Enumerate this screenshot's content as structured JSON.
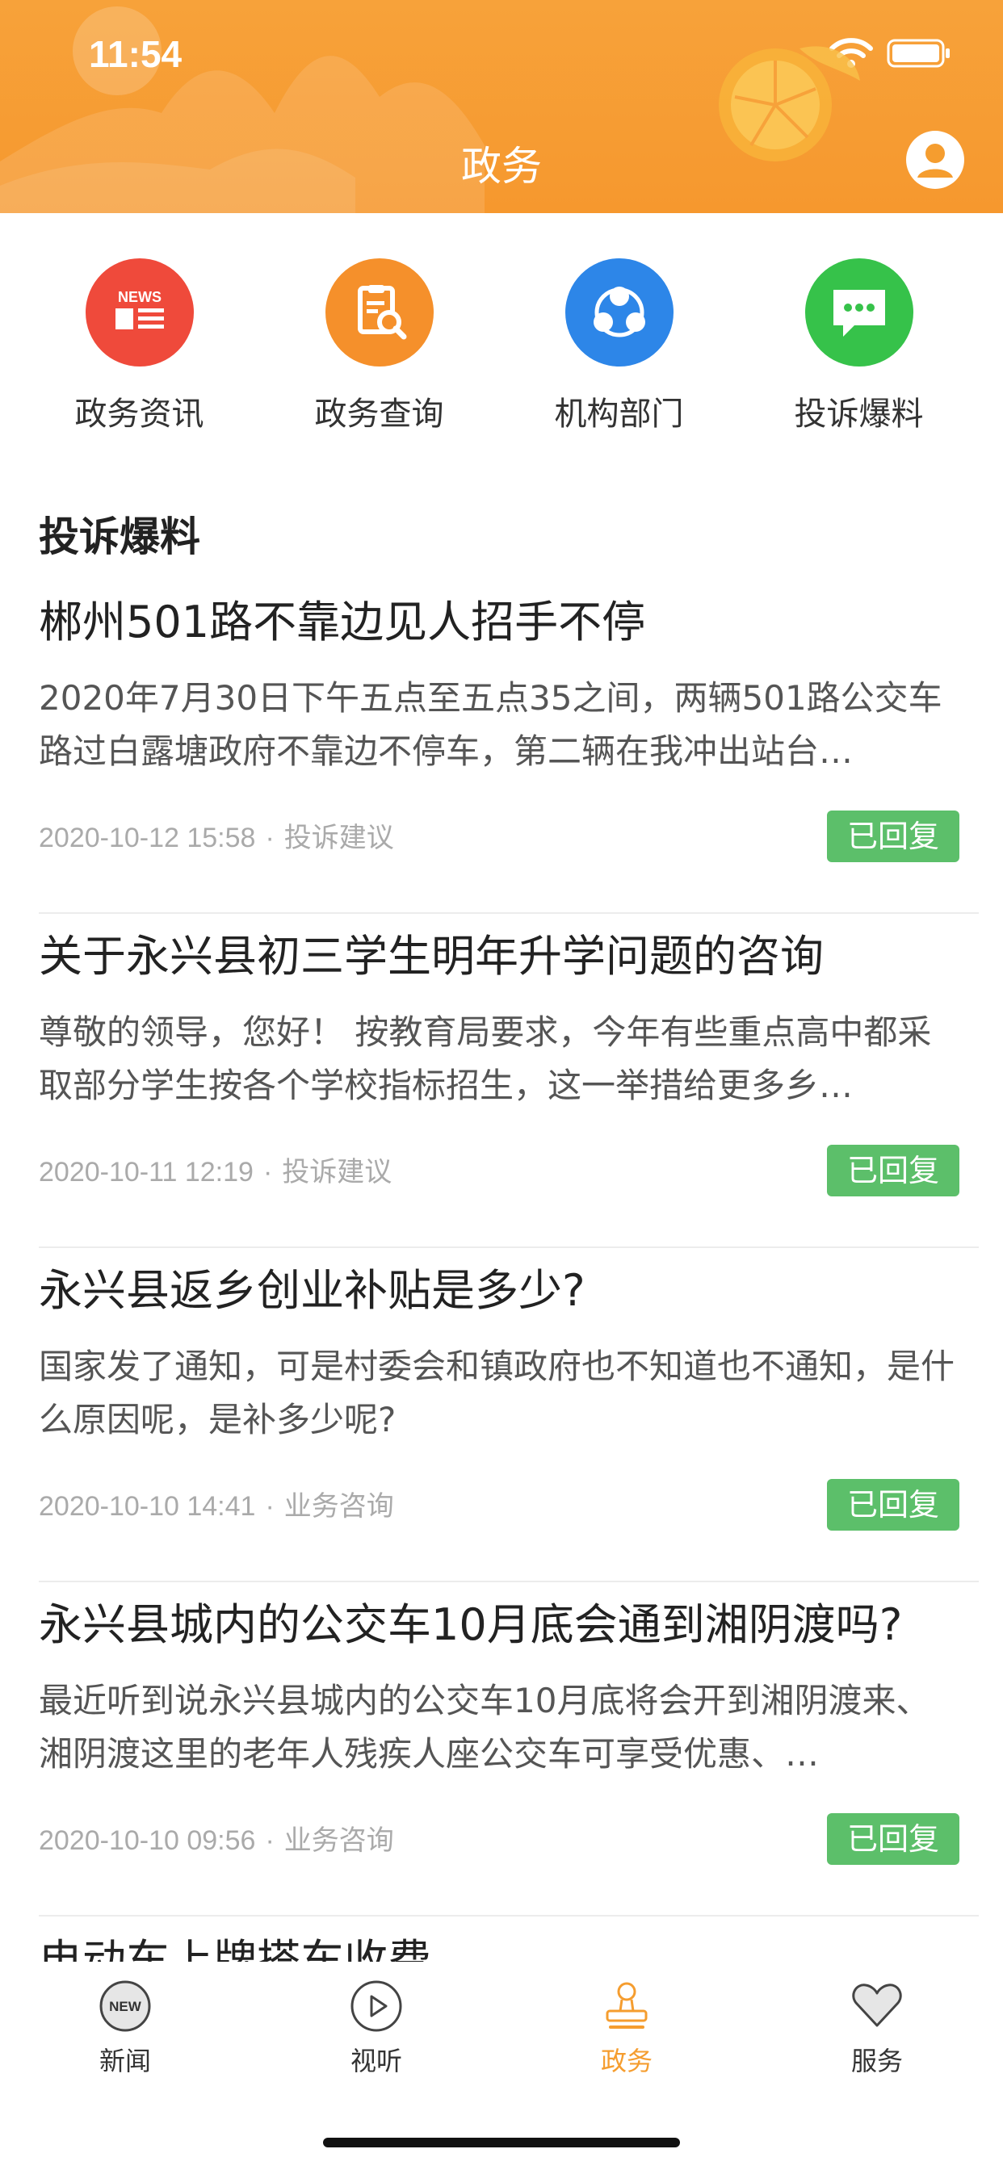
{
  "status": {
    "time": "11:54"
  },
  "header": {
    "title": "政务"
  },
  "quick_links": [
    {
      "label": "政务资讯",
      "icon": "news-icon",
      "color": "#ef4a3b"
    },
    {
      "label": "政务查询",
      "icon": "search-doc-icon",
      "color": "#f5902b"
    },
    {
      "label": "机构部门",
      "icon": "organization-icon",
      "color": "#2d86e8"
    },
    {
      "label": "投诉爆料",
      "icon": "message-icon",
      "color": "#36c24a"
    }
  ],
  "section": {
    "title": "投诉爆料"
  },
  "items": [
    {
      "title": "郴州501路不靠边见人招手不停",
      "desc": "2020年7月30日下午五点至五点35之间，两辆501路公交车路过白露塘政府不靠边不停车，第二辆在我冲出站台…",
      "date": "2020-10-12 15:58",
      "category": "投诉建议",
      "status": "已回复"
    },
    {
      "title": "关于永兴县初三学生明年升学问题的咨询",
      "desc": "尊敬的领导，您好！ 按教育局要求，今年有些重点高中都采取部分学生按各个学校指标招生，这一举措给更多乡…",
      "date": "2020-10-11 12:19",
      "category": "投诉建议",
      "status": "已回复"
    },
    {
      "title": "永兴县返乡创业补贴是多少?",
      "desc": "国家发了通知，可是村委会和镇政府也不知道也不通知，是什么原因呢，是补多少呢?",
      "date": "2020-10-10 14:41",
      "category": "业务咨询",
      "status": "已回复"
    },
    {
      "title": "永兴县城内的公交车10月底会通到湘阴渡吗?",
      "desc": "最近听到说永兴县城内的公交车10月底将会开到湘阴渡来、湘阴渡这里的老年人残疾人座公交车可享受优惠、…",
      "date": "2020-10-10 09:56",
      "category": "业务咨询",
      "status": "已回复"
    }
  ],
  "partial_item": {
    "title": "电动车上牌搭车收费"
  },
  "tabs": [
    {
      "label": "新闻",
      "icon": "new-badge-icon"
    },
    {
      "label": "视听",
      "icon": "play-icon"
    },
    {
      "label": "政务",
      "icon": "stamp-icon"
    },
    {
      "label": "服务",
      "icon": "heart-icon"
    }
  ],
  "colors": {
    "brand": "#f59d2f",
    "badge": "#5cbf6a"
  }
}
